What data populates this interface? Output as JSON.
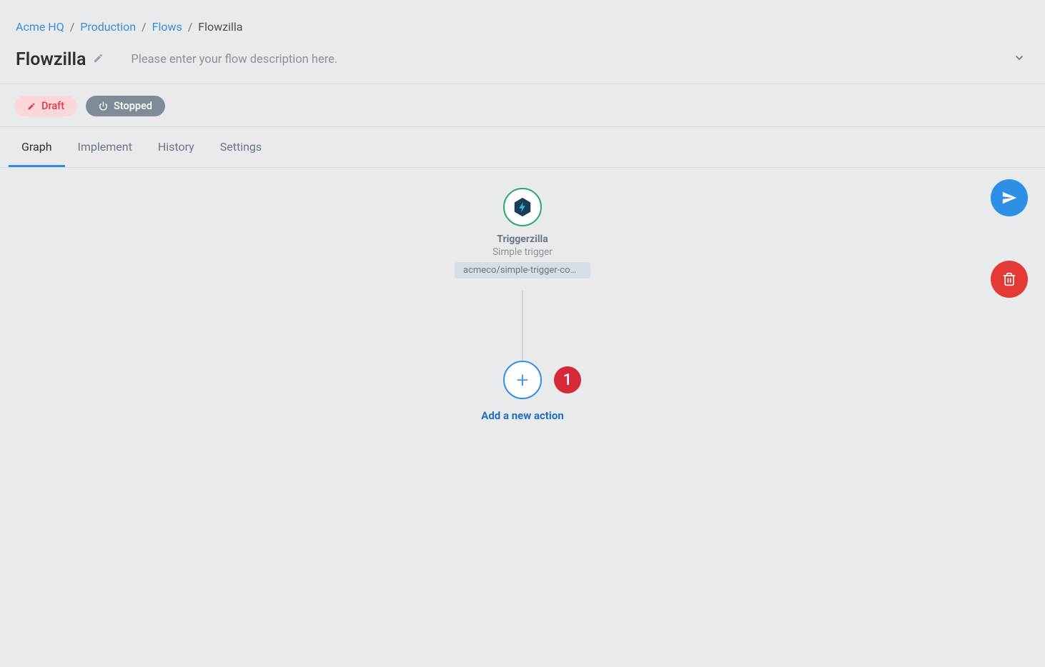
{
  "breadcrumb": {
    "items": [
      "Acme HQ",
      "Production",
      "Flows"
    ],
    "current": "Flowzilla"
  },
  "header": {
    "title": "Flowzilla",
    "description_placeholder": "Please enter your flow description here."
  },
  "status": {
    "draft_label": "Draft",
    "stopped_label": "Stopped"
  },
  "tabs": {
    "items": [
      "Graph",
      "Implement",
      "History",
      "Settings"
    ],
    "active_index": 0
  },
  "trigger_node": {
    "title": "Triggerzilla",
    "subtitle": "Simple trigger",
    "tag": "acmeco/simple-trigger-com..."
  },
  "add_node": {
    "label": "Add a new action"
  },
  "callout": {
    "number": "1"
  },
  "colors": {
    "link": "#3b8dd6",
    "primary": "#2f8fe6",
    "danger": "#e53935",
    "draft_bg": "#fbd7db",
    "draft_fg": "#e03647",
    "stopped_bg": "#808b98",
    "success_border": "#28a86b"
  }
}
